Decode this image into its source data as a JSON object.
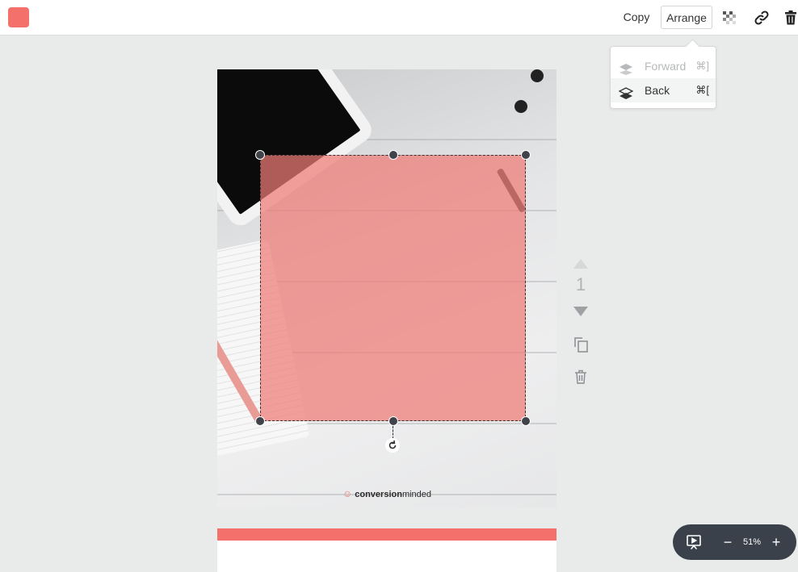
{
  "toolbar": {
    "accent_color": "#f4706a",
    "copy_label": "Copy",
    "arrange_label": "Arrange",
    "icons": [
      "transparency-icon",
      "link-icon",
      "trash-icon"
    ]
  },
  "arrange_menu": {
    "items": [
      {
        "label": "Forward",
        "shortcut": "⌘]",
        "enabled": false,
        "icon": "layers-up-icon"
      },
      {
        "label": "Back",
        "shortcut": "⌘[",
        "enabled": true,
        "icon": "layers-down-icon"
      }
    ]
  },
  "page": {
    "logo_prefix": "conversion",
    "logo_suffix": "minded",
    "shape_color": "#ef7a76"
  },
  "page_controls": {
    "page_number": "1",
    "icons": [
      "move-page-up-icon",
      "move-page-down-icon",
      "duplicate-page-icon",
      "delete-page-icon"
    ]
  },
  "next_page": {
    "bar_color": "#f4706a"
  },
  "zoom": {
    "minus": "−",
    "value": "51%",
    "plus": "+"
  }
}
